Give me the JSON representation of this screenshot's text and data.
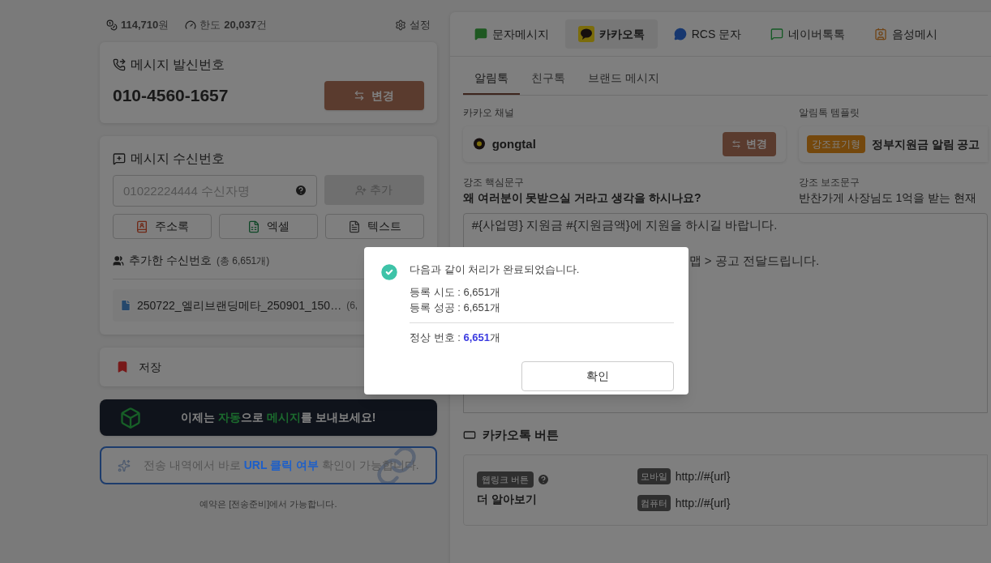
{
  "stats": {
    "balance": "114,710",
    "balance_unit": "원",
    "limit_label": "한도",
    "limit": "20,037",
    "limit_unit": "건",
    "settings": "설정"
  },
  "sender": {
    "title": "메시지 발신번호",
    "number": "010-4560-1657",
    "change_button": "변경"
  },
  "recipient": {
    "title": "메시지 수신번호",
    "placeholder": "01022224444 수신자명",
    "add_button": "추가",
    "add_disabled": true,
    "sources": [
      {
        "kind": "address",
        "label": "주소록"
      },
      {
        "kind": "excel",
        "label": "엑셀"
      },
      {
        "kind": "text",
        "label": "텍스트"
      }
    ],
    "added_title": "추가한 수신번호",
    "added_total": "(총 6,651개)",
    "files": [
      {
        "name": "250722_엘리브랜딩메타_250901_150…",
        "count": "(6,"
      }
    ]
  },
  "save": "저장",
  "promo": [
    {
      "text": "이제는 ",
      "highlight": false
    },
    {
      "text": "자동",
      "highlight": true
    },
    {
      "text": "으로 ",
      "highlight": false
    },
    {
      "text": "메시지",
      "highlight": true
    },
    {
      "text": "를 보내보세요!",
      "highlight": false
    }
  ],
  "url_banner": [
    {
      "text": "전송 내역에서 바로 ",
      "highlight": false
    },
    {
      "text": "URL 클릭 여부",
      "highlight": true
    },
    {
      "text": " 확인이 가능합니다.",
      "highlight": false
    }
  ],
  "reserve_note": "예약은 [전송준비]에서 가능합니다.",
  "channel_tabs": [
    {
      "kind": "sms",
      "label": "문자메시지",
      "selected": false
    },
    {
      "kind": "kakao",
      "label": "카카오톡",
      "selected": true
    },
    {
      "kind": "rcs",
      "label": "RCS 문자",
      "selected": false
    },
    {
      "kind": "naver",
      "label": "네이버톡톡",
      "selected": false
    },
    {
      "kind": "voice",
      "label": "음성메시",
      "selected": false
    }
  ],
  "sub_tabs": [
    {
      "label": "알림톡",
      "selected": true
    },
    {
      "label": "친구톡",
      "selected": false
    },
    {
      "label": "브랜드 메시지",
      "selected": false
    }
  ],
  "kakao_channel": {
    "label": "카카오 채널",
    "name": "gongtal",
    "change_button": "변경"
  },
  "template": {
    "label": "알림톡 템플릿",
    "badge": "강조표기형",
    "name": "정부지원금 알림 공고"
  },
  "emphasis": [
    {
      "label": "강조 핵심문구",
      "text": "왜 여러분이 못받으실 거라고 생각을 하시나요?",
      "bold": true
    },
    {
      "label": "강조 보조문구",
      "text": "반찬가게 사장님도 1억을 받는 현재",
      "bold": false
    }
  ],
  "message_lines": [
    {
      "kind": "full",
      "text": "#{사업명} 지원금 #{지원금액}에 지원을 하시길 바랍니다."
    },
    {
      "kind": "partial",
      "text": "맵 > 공고 전달드립니다."
    }
  ],
  "kakao_buttons": {
    "title": "카카오톡 버튼",
    "button_type": "웹링크 버튼",
    "name": "더 알아보기",
    "links": [
      {
        "label": "모바일",
        "url": "http://#{url}"
      },
      {
        "label": "컴퓨터",
        "url": "http://#{url}"
      }
    ]
  },
  "dialog": {
    "message": "다음과 같이 처리가 완료되었습니다.",
    "rows": [
      "등록 시도 : 6,651개",
      "등록 성공 : 6,651개"
    ],
    "normal_label": "정상 번호 : ",
    "normal_value": "6,651",
    "normal_unit": "개",
    "confirm": "확인"
  }
}
